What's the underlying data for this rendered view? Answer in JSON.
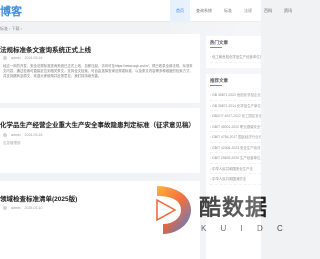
{
  "site": {
    "logo_text": "博客"
  },
  "nav": {
    "items": [
      "首页",
      "查询系统",
      "标准",
      "法规",
      "百科",
      "资讯"
    ]
  },
  "breadcrumb": "标准 ›  下载 ›",
  "posts": [
    {
      "title": "法规标准条文查询系统正式上线",
      "author": "admin",
      "date": "2024-03-16",
      "summary": "经过一年的开发，安全法规标准查询系统已正式上线，自即日起，访问可至https://www.aqb.cn/cx/，现已收录全部法规、标准条文内容，通过检索可直接定位到相关条文，支持全文检索，可自由选择查询法规或标准，以及条文内容等多种维度的检索方式，并支持跳转至原文，欢迎大家使用并反馈意见，我们将持续完善。",
      "tag": ""
    },
    {
      "title": "化学品生产经营企业重大生产安全事故隐患判定标准（征求意见稿）",
      "author": "admin",
      "date": "2024-03-16",
      "summary": "",
      "tag": "应急管理部"
    },
    {
      "title": "领域检查标准清单(2025版)",
      "author": "admin",
      "date": "2025-01-10",
      "summary": "",
      "tag": ""
    }
  ],
  "sidebar": {
    "hot": {
      "title": "热门文章",
      "items": [
        "化工和危险化学品生产经营单位重大生产安全事故隐患判定标准"
      ]
    },
    "recommend": {
      "title": "推荐文章",
      "items": [
        "GB 30871-2022 危险化学品企业特殊作业安全规范",
        "GB 30871-2014 化学品生产单位特殊作业安全规范",
        "DB37/T 4027-2022 化工园区安全风险...",
        "GB/T 45001-2020 职业健康安全管理体系",
        "GB/T 4754-2017 国民经济行业分类",
        "GB/T 42304-2023 安全生产培训",
        "GB/T 29639-2020 生产经营单位生产安全事故应急预案编制导则",
        "中华人民共和国安全生产法",
        "中华人民共和国消防法"
      ]
    }
  },
  "watermark": {
    "main": "酷数据",
    "sub": "K U I D C"
  }
}
